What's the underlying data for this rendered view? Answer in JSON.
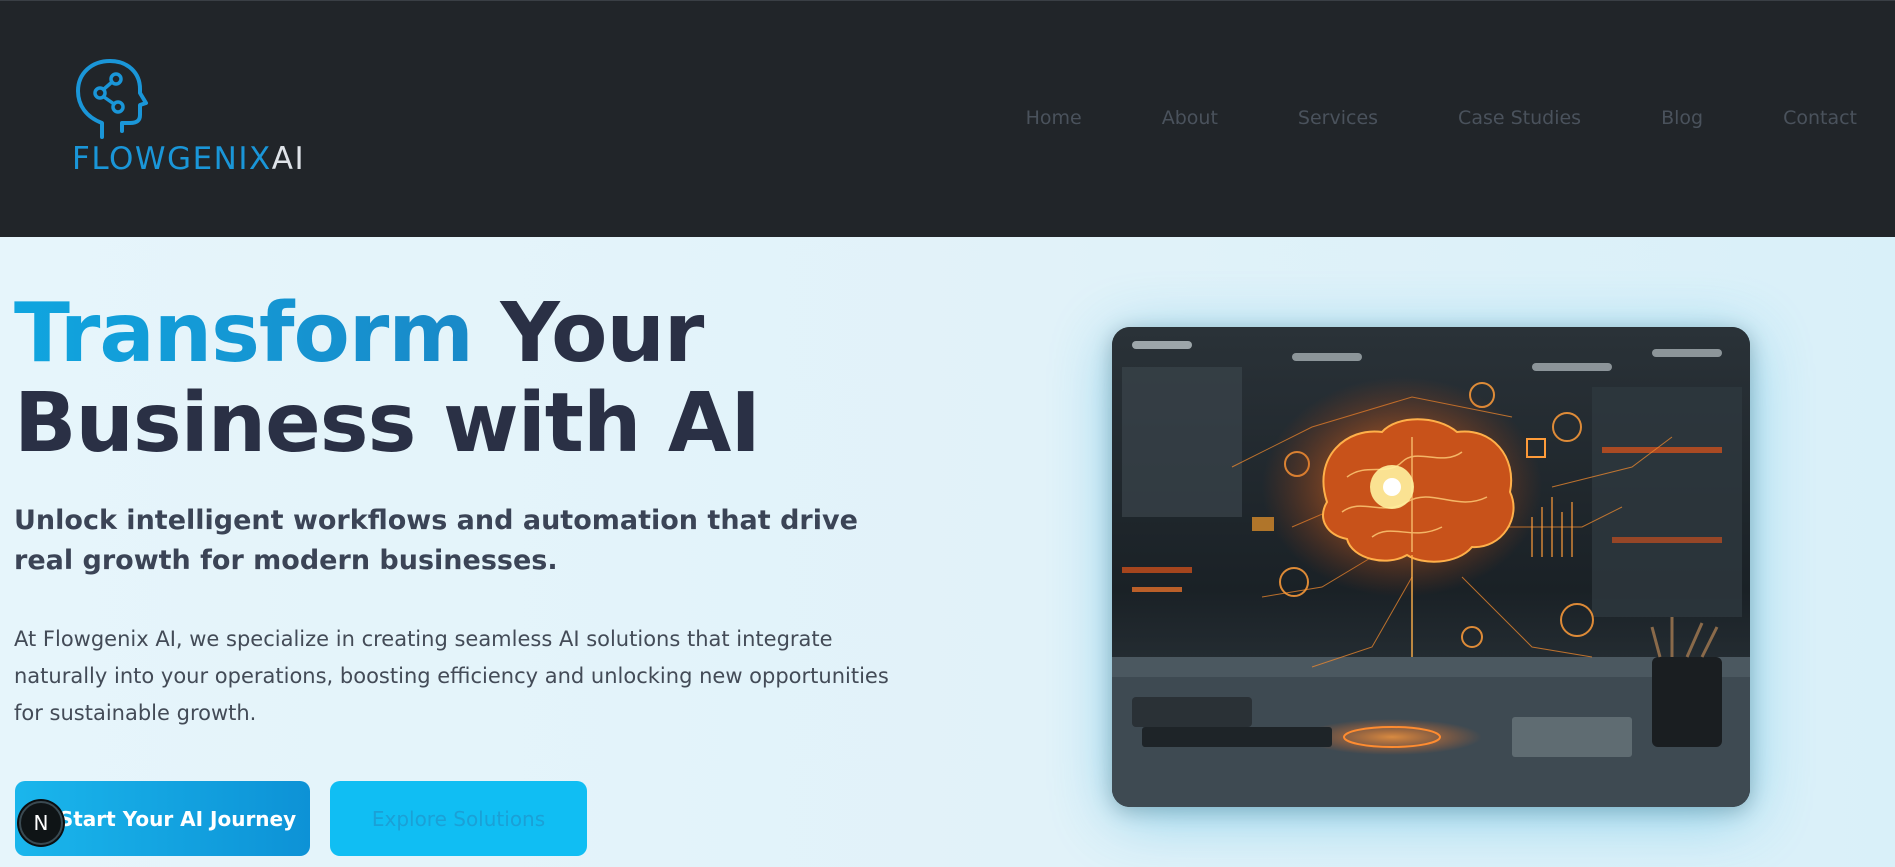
{
  "brand": {
    "name_main": "FLOWGENIX",
    "name_suffix": "AI",
    "icon": "brain-head-icon",
    "colors": {
      "primary": "#1a96d8",
      "suffix": "#dfe3e8"
    }
  },
  "nav": {
    "items": [
      "Home",
      "About",
      "Services",
      "Case Studies",
      "Blog",
      "Contact"
    ]
  },
  "hero": {
    "headline_accent": "Transform",
    "headline_rest_1": " Your",
    "headline_line_2": "Business with AI",
    "subheading": "Unlock intelligent workflows and automation that drive real growth for modern businesses.",
    "description": "At Flowgenix AI, we specialize in creating seamless AI solutions that integrate naturally into your operations, boosting efficiency and unlocking new opportunities for sustainable growth.",
    "primary_button": "Start Your AI Journey",
    "secondary_button": "Explore Solutions",
    "image_icon": "glowing-brain-office-image"
  },
  "badge": {
    "label": "N",
    "icon": "nextjs-badge-icon"
  },
  "colors": {
    "header_bg": "#212529",
    "hero_bg": "#e3f3fa",
    "accent": "#10a5df",
    "heading": "#2a3045"
  }
}
